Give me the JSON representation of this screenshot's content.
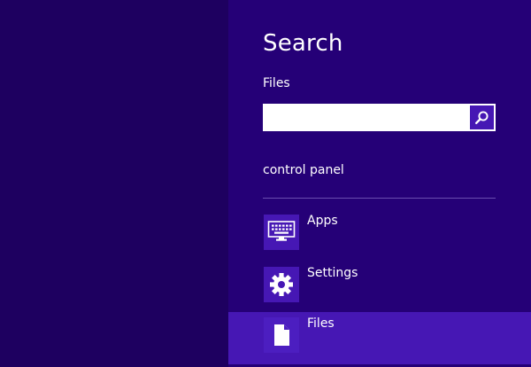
{
  "pane": {
    "title": "Search",
    "scope": "Files"
  },
  "search": {
    "value": "",
    "placeholder": ""
  },
  "suggestions": [
    {
      "label": "control panel"
    }
  ],
  "scopes": [
    {
      "label": "Apps",
      "icon": "keyboard-icon",
      "selected": false
    },
    {
      "label": "Settings",
      "icon": "gear-icon",
      "selected": false
    },
    {
      "label": "Files",
      "icon": "document-icon",
      "selected": true
    }
  ],
  "colors": {
    "desktop_background": "#1e0060",
    "pane_background": "#250077",
    "accent": "#4617b4"
  }
}
